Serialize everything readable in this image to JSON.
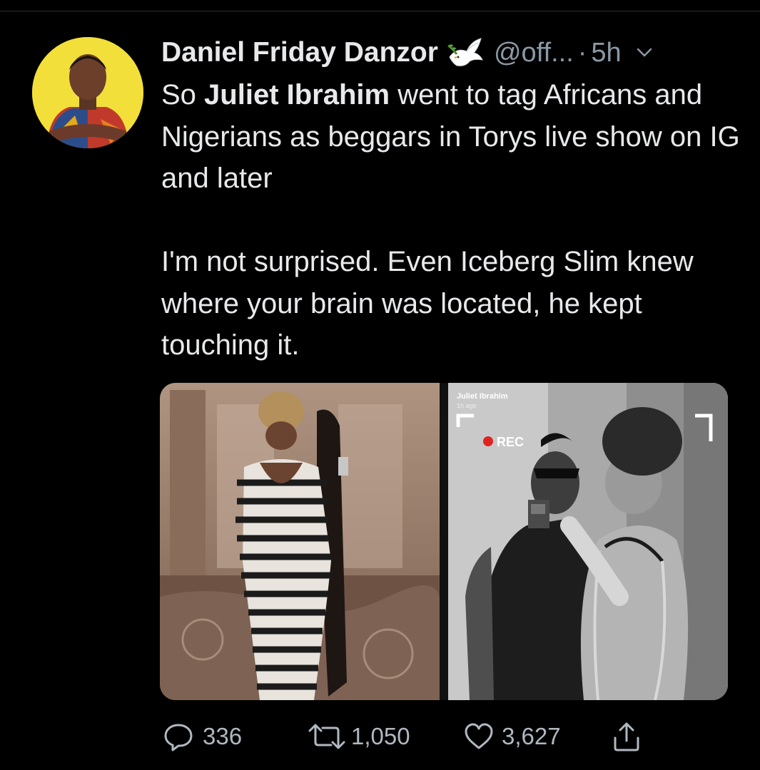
{
  "tweet": {
    "author_name": "Daniel Friday Danzor",
    "author_emoji": "dove-of-peace-icon",
    "handle": "@off...",
    "separator": "·",
    "time": "5h",
    "text_intro": "So ",
    "text_bold": "Juliet Ibrahim",
    "text_rest": " went to tag Africans and Nigerians as beggars in Torys live show on IG and later\n\nI'm not surprised. Even Iceberg Slim knew where your brain was located, he kept touching it."
  },
  "media": {
    "left_photo": "mirror-selfie-photo",
    "right_photo": "instagram-story-screenshot",
    "story_username": "Juliet Ibrahim",
    "story_time": "1h ago",
    "story_rec_label": "REC"
  },
  "actions": {
    "replies": "336",
    "retweets": "1,050",
    "likes": "3,627"
  },
  "colors": {
    "background": "#000000",
    "text": "#e7e9ea",
    "muted": "#8b98a5",
    "avatar_bg": "#f3df3a"
  }
}
